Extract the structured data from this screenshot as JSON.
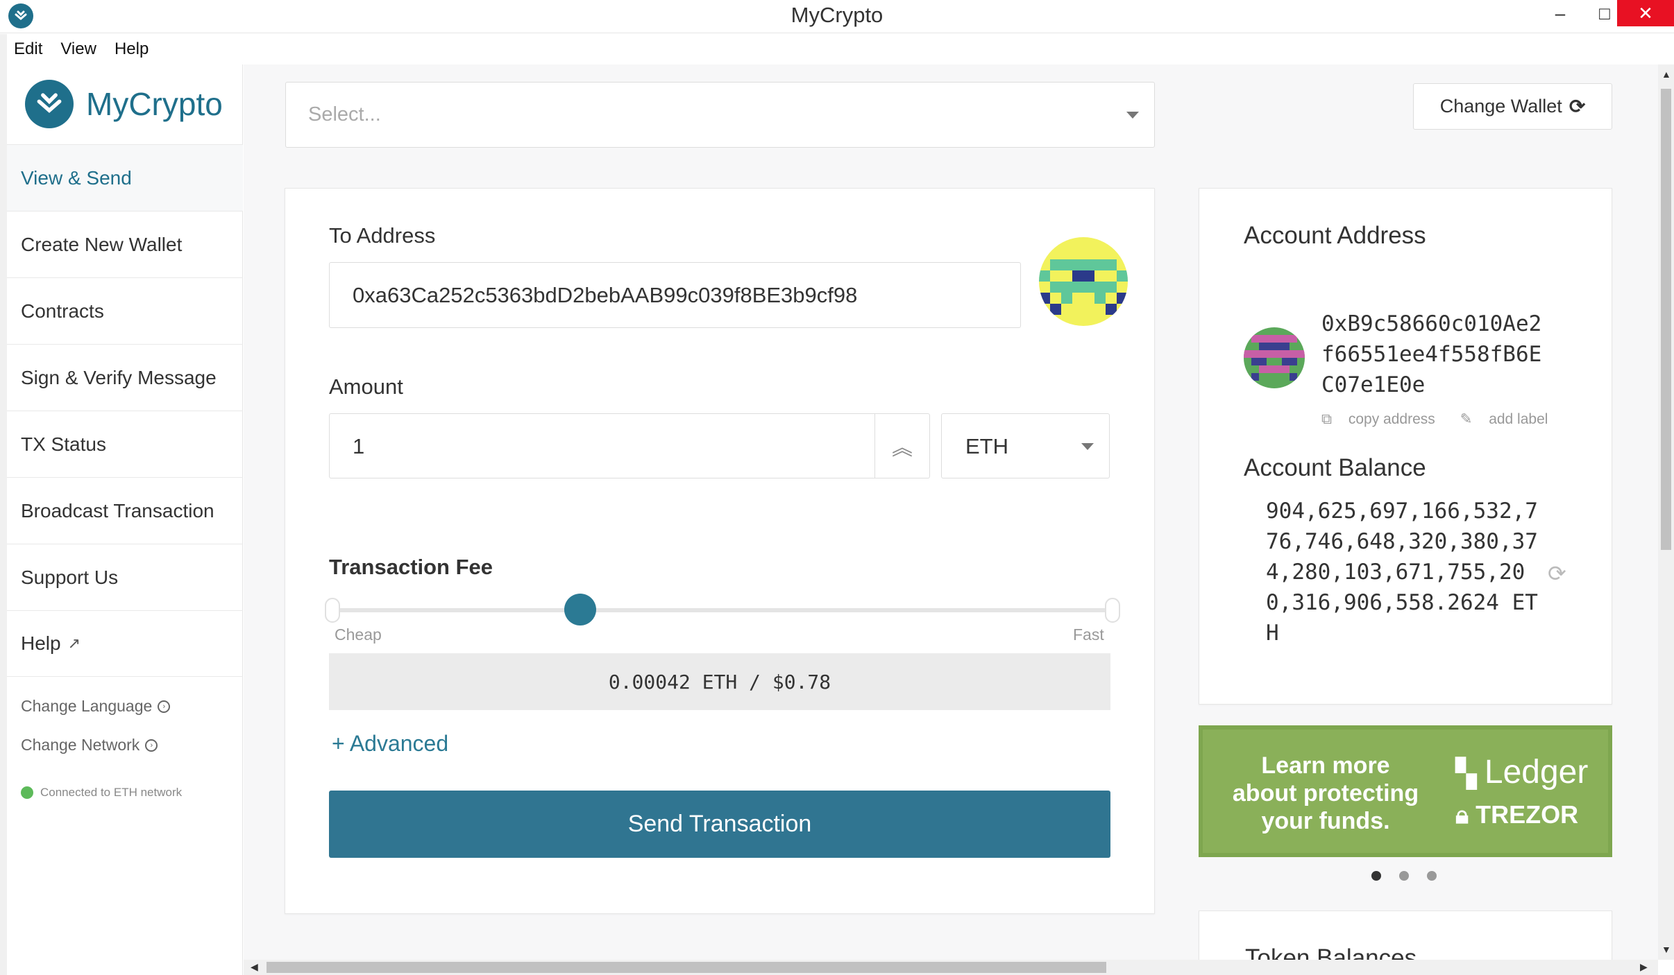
{
  "window": {
    "title": "MyCrypto",
    "minimize": "–",
    "maximize": "□",
    "close": "✕"
  },
  "menu": [
    "Edit",
    "View",
    "Help"
  ],
  "brand": {
    "name": "MyCrypto"
  },
  "sidebar": {
    "items": [
      {
        "label": "View & Send",
        "active": true
      },
      {
        "label": "Create New Wallet"
      },
      {
        "label": "Contracts"
      },
      {
        "label": "Sign & Verify Message"
      },
      {
        "label": "TX Status"
      },
      {
        "label": "Broadcast Transaction"
      },
      {
        "label": "Support Us"
      },
      {
        "label": "Help"
      }
    ],
    "change_language": "Change Language",
    "change_network": "Change Network",
    "status": "Connected to ETH network"
  },
  "header": {
    "select_placeholder": "Select...",
    "change_wallet": "Change Wallet"
  },
  "send": {
    "to_label": "To Address",
    "to_value": "0xa63Ca252c5363bdD2bebAAB99c039f8BE3b9cf98",
    "amount_label": "Amount",
    "amount_value": "1",
    "currency": "ETH",
    "fee_title": "Transaction Fee",
    "fee_low_label": "Cheap",
    "fee_high_label": "Fast",
    "fee_level": 0.32,
    "fee_value": "0.00042 ETH / $0.78",
    "advanced": "+ Advanced",
    "send_button": "Send Transaction"
  },
  "account": {
    "address_title": "Account Address",
    "address": "0xB9c58660c010Ae2f66551ee4f558fB6EC07e1E0e",
    "copy_address": "copy address",
    "add_label": "add label",
    "balance_title": "Account Balance",
    "balance": "904,625,697,166,532,776,746,648,320,380,374,280,103,671,755,200,316,906,558.2624 ETH"
  },
  "banner": {
    "text": "Learn more about protecting your funds.",
    "ledger": "Ledger",
    "trezor": "TREZOR"
  },
  "carousel": {
    "count": 3,
    "active": 0
  },
  "token_title": "Token Balances",
  "colors": {
    "brand": "#1f6f8b",
    "accent": "#307591",
    "banner": "#8ab059",
    "connected": "#5dba5a"
  }
}
